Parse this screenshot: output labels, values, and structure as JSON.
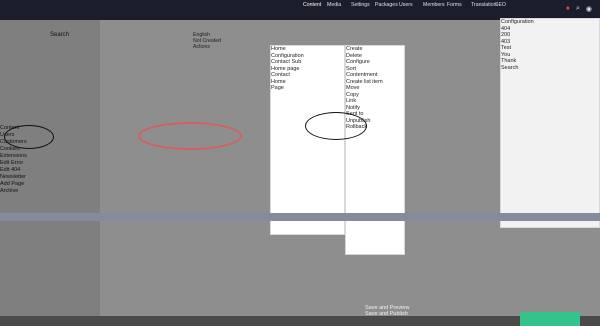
{
  "topbar": {
    "nav": [
      "Content",
      "Media",
      "Settings",
      "Packages",
      "Users",
      "Members",
      "Forms",
      "Translation",
      "SEO"
    ],
    "nav_active_index": 0
  },
  "left_panel": {
    "search_label": "Search",
    "items": [
      "Content",
      "Users",
      "Customers",
      "Cookies",
      "Extensions",
      "Edit Error",
      "Edit 404",
      "Newsletter",
      "Add Page",
      "Archive"
    ]
  },
  "editor": {
    "language": "English",
    "status": "Not Created",
    "actions": "Actions"
  },
  "action_menu": {
    "items": [
      "Create",
      "Delete",
      "Configure",
      "Sort",
      "Contentment",
      "Create list item",
      "Move",
      "Copy",
      "Link",
      "Notify",
      "Sent to",
      "Unpublish",
      "Rollback"
    ]
  },
  "context_menu": {
    "items": [
      "Home",
      "Configuration",
      "Contact Sub",
      "Home page",
      "Contact",
      "Home",
      "Page"
    ]
  },
  "right_panel": {
    "items": [
      "Configuration",
      "404",
      "200",
      "403",
      "Test",
      "You",
      "Thank",
      "Search"
    ]
  },
  "footer": {
    "text_line1": "Save and Preview",
    "text_line2": "Save and Publish"
  },
  "colors": {
    "accent": "#34c48b",
    "annotation": "#e35555",
    "topbar": "#1b1d2b"
  }
}
